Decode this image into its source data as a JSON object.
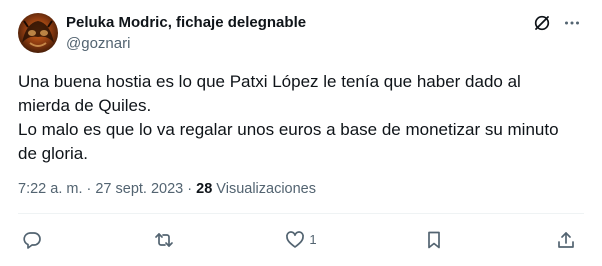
{
  "author": {
    "display_name": "Peluka Modric, fichaje delegnable",
    "handle": "@goznari"
  },
  "top_icons": [
    "grok-icon",
    "more-icon"
  ],
  "tweet": {
    "lines": [
      "Una buena hostia es lo que Patxi López le tenía que haber dado al",
      "mierda de Quiles.",
      "Lo malo es que lo va regalar unos euros a base de monetizar su minuto",
      "de gloria."
    ]
  },
  "meta": {
    "timestamp": "7:22 a. m. · 27 sept. 2023 · ",
    "views_count": "28",
    "views_label": " Visualizaciones"
  },
  "actions": {
    "reply_count": "",
    "retweet_count": "",
    "like_count": "1",
    "bookmark_count": "",
    "share_count": ""
  },
  "colors": {
    "text": "#0f1419",
    "muted": "#536471",
    "divider": "#eff3f4"
  }
}
